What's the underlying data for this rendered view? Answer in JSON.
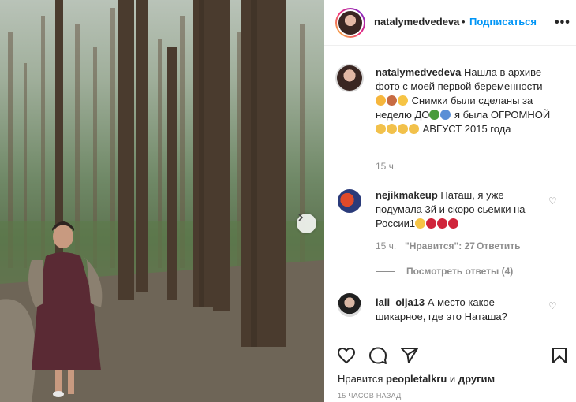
{
  "post": {
    "author": "natalymedvedeva",
    "dot": "•",
    "follow_label": "Подписаться",
    "more_icon": "more-horizontal-icon"
  },
  "caption": {
    "username": "natalymedvedeva",
    "text_1": "Нашла в архиве фото с моей первой беременности",
    "text_2": "Снимки были сделаны за неделю ДО",
    "text_3": "я была ОГРОМНОЙ",
    "text_4": "АВГУСТ 2015 года",
    "time": "15 ч."
  },
  "comments": [
    {
      "username": "nejikmakeup",
      "text": "Наташ, я уже подумала 3й и скоро сьемки на России1",
      "time": "15 ч.",
      "likes": "\"Нравится\": 27",
      "reply": "Ответить",
      "view_replies": "Посмотреть ответы (4)"
    },
    {
      "username": "lali_olja13",
      "text": "А место какое шикарное, где это Наташа?"
    }
  ],
  "actions": {
    "liked_by_prefix": "Нравится",
    "liked_by_user": "peopletalkru",
    "liked_by_and": "и",
    "liked_by_others": "другим",
    "time_ago": "15 ЧАСОВ НАЗАД"
  },
  "colors": {
    "link": "#0095f6",
    "secondary": "#8e8e8e",
    "text": "#262626"
  }
}
